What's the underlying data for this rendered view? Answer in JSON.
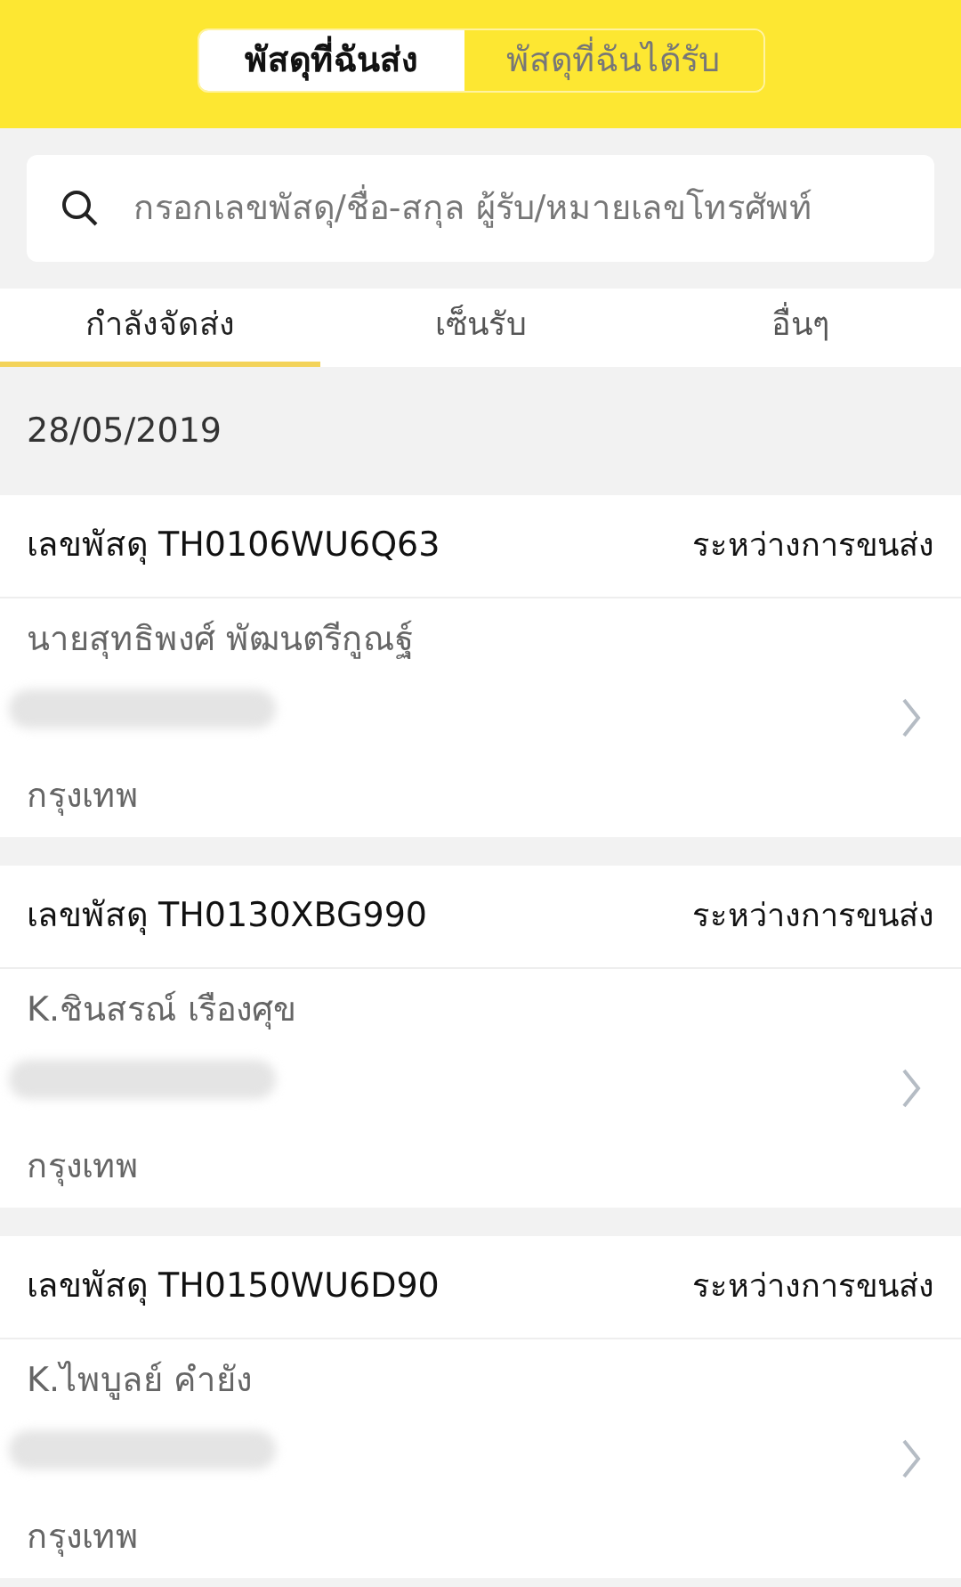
{
  "segments": [
    {
      "label": "พัสดุที่ฉันส่ง",
      "selected": true
    },
    {
      "label": "พัสดุที่ฉันได้รับ",
      "selected": false
    }
  ],
  "search": {
    "placeholder": "กรอกเลขพัสดุ/ชื่อ-สกุล ผู้รับ/หมายเลขโทรศัพท์"
  },
  "tabs": [
    {
      "label": "กำลังจัดส่ง",
      "selected": true
    },
    {
      "label": "เซ็นรับ",
      "selected": false
    },
    {
      "label": "อื่นๆ",
      "selected": false
    }
  ],
  "date": "28/05/2019",
  "parcels": [
    {
      "number": "เลขพัสดุ TH0106WU6Q63",
      "status": "ระหว่างการขนส่ง",
      "name": "นายสุทธิพงศ์ พัฒนตรีกูณฐ์",
      "phone_redacted": true,
      "city": "กรุงเทพ"
    },
    {
      "number": "เลขพัสดุ TH0130XBG990",
      "status": "ระหว่างการขนส่ง",
      "name": "K.ชินสรณ์ เรืองศุข",
      "phone_redacted": true,
      "city": "กรุงเทพ"
    },
    {
      "number": "เลขพัสดุ TH0150WU6D90",
      "status": "ระหว่างการขนส่ง",
      "name": "K.ไพบูลย์ คำยัง",
      "phone_redacted": true,
      "city": "กรุงเทพ"
    }
  ]
}
